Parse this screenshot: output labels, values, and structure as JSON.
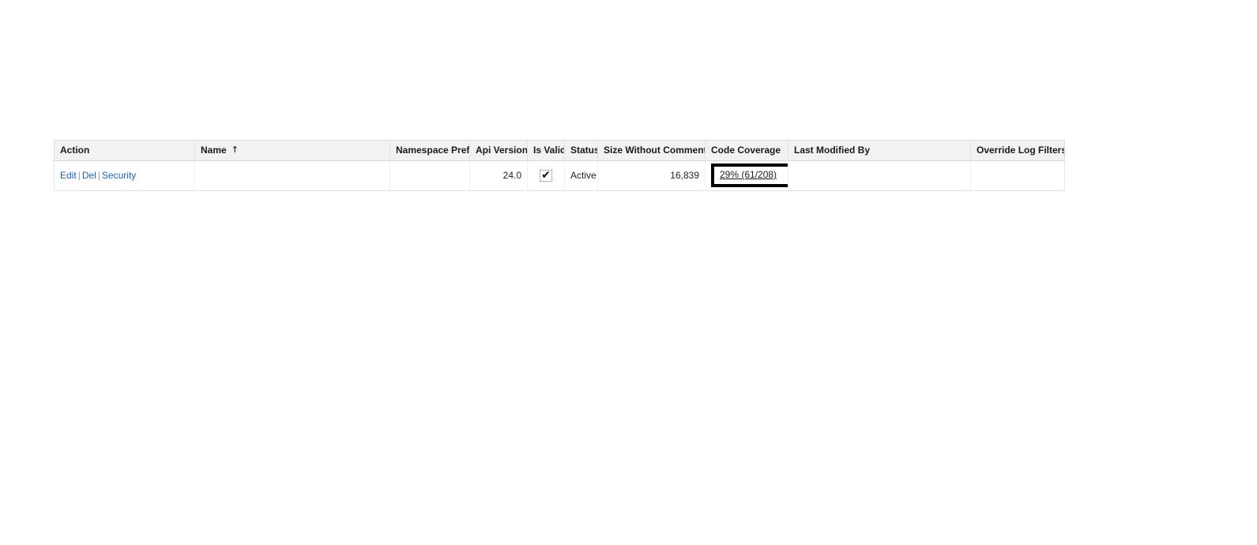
{
  "table": {
    "name": "apex-classes-list",
    "columns": [
      {
        "key": "action",
        "label": "Action",
        "align": "left",
        "sorted": false
      },
      {
        "key": "name",
        "label": "Name",
        "align": "left",
        "sorted": true,
        "sort_direction": "ascending",
        "sort_icon": "sort-ascending-arrow",
        "sort_glyph": "↑"
      },
      {
        "key": "namespace",
        "label": "Namespace Prefix",
        "align": "right",
        "sorted": false
      },
      {
        "key": "api",
        "label": "Api Version",
        "align": "right",
        "sorted": false
      },
      {
        "key": "valid",
        "label": "Is Valid",
        "align": "center",
        "sorted": false
      },
      {
        "key": "status",
        "label": "Status",
        "align": "left",
        "sorted": false
      },
      {
        "key": "size",
        "label": "Size Without Comments",
        "align": "right",
        "sorted": false
      },
      {
        "key": "coverage",
        "label": "Code Coverage",
        "align": "left",
        "sorted": false
      },
      {
        "key": "lastmod",
        "label": "Last Modified By",
        "align": "left",
        "sorted": false
      },
      {
        "key": "override",
        "label": "Override Log Filters",
        "align": "left",
        "sorted": false
      }
    ],
    "rows": [
      {
        "actions": [
          {
            "label": "Edit",
            "name": "edit-link"
          },
          {
            "label": "Del",
            "name": "delete-link"
          },
          {
            "label": "Security",
            "name": "security-link"
          }
        ],
        "action_separator": "|",
        "name": "",
        "namespace_prefix": "",
        "api_version": "24.0",
        "is_valid": true,
        "is_valid_icon": "checkmark-icon",
        "is_valid_glyph": "✔",
        "status": "Active",
        "size_without_comments": "16,839",
        "code_coverage": "29% (61/208)",
        "code_coverage_focused": true,
        "last_modified_by": "",
        "override_log_filters": ""
      }
    ]
  },
  "colors": {
    "link": "#1863c6",
    "header_background": "#f2f2f2",
    "border": "#e0e0e0",
    "focus_outline": "#000000",
    "text": "#222222"
  }
}
